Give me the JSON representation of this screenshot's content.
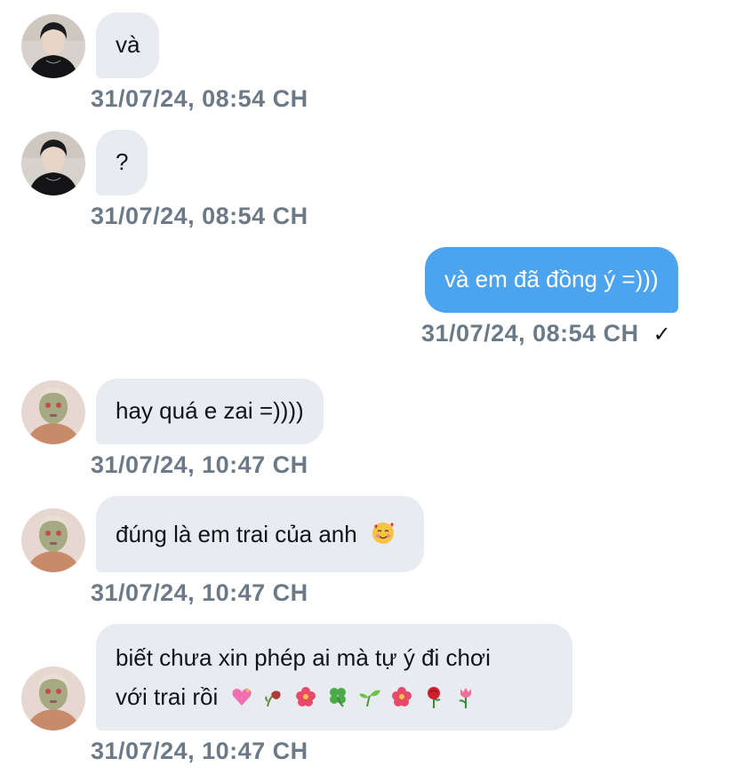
{
  "colors": {
    "incoming_bubble": "#e8ecf0",
    "outgoing_bubble": "#4ca3ee",
    "timestamp": "#6c7a88"
  },
  "messages": [
    {
      "sender": "other",
      "avatar": "avatar-dark-hair",
      "text": "và",
      "time": "31/07/24, 08:54 CH"
    },
    {
      "sender": "other",
      "avatar": "avatar-dark-hair",
      "text": "?",
      "time": "31/07/24, 08:54 CH"
    },
    {
      "sender": "me",
      "text": "và em đã đồng ý =)))",
      "time": "31/07/24, 08:54 CH",
      "status": "✓"
    },
    {
      "sender": "other",
      "avatar": "avatar-face-mask",
      "text": "hay quá e zai =))))",
      "time": "31/07/24, 10:47 CH"
    },
    {
      "sender": "other",
      "avatar": "avatar-face-mask",
      "text": "đúng là em trai của anh",
      "emoji": "smiling-face-with-hearts-icon",
      "time": "31/07/24, 10:47 CH"
    },
    {
      "sender": "other",
      "avatar": "avatar-face-mask",
      "text_line1": "biết chưa xin phép ai mà tự ý đi chơi",
      "text_line2": "với trai rồi",
      "emojis": [
        "sparkling-heart-icon",
        "wilted-flower-icon",
        "hibiscus-icon",
        "four-leaf-clover-icon",
        "seedling-icon",
        "hibiscus-icon",
        "rose-icon",
        "tulip-icon"
      ],
      "time": "31/07/24, 10:47 CH"
    }
  ]
}
